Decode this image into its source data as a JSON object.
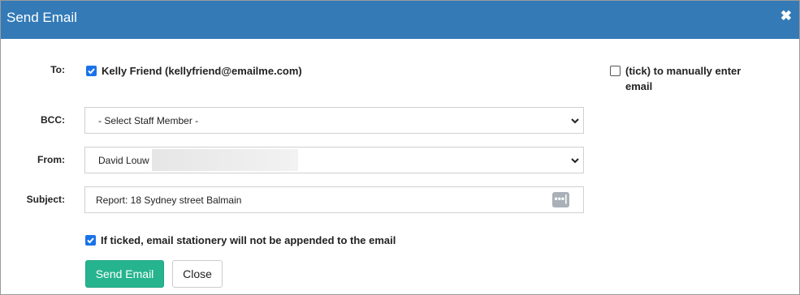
{
  "dialog": {
    "title": "Send Email",
    "close_icon": "close-icon"
  },
  "to": {
    "label": "To:",
    "recipient": "Kelly Friend (kellyfriend@emailme.com)",
    "recipient_checked": true,
    "manual_line1": "(tick) to manually enter",
    "manual_line2": "email",
    "manual_checked": false
  },
  "bcc": {
    "label": "BCC:",
    "selected": "- Select Staff Member -"
  },
  "from": {
    "label": "From:",
    "selected": "David Louw"
  },
  "subject": {
    "label": "Subject:",
    "value": "Report: 18 Sydney street Balmain",
    "dots": "•••|"
  },
  "stationery": {
    "text": "If ticked, email stationery will not be appended to the email",
    "checked": true
  },
  "buttons": {
    "send": "Send Email",
    "close": "Close"
  },
  "colors": {
    "header": "#337ab7",
    "primary": "#26b48f",
    "checkbox": "#1a73e8"
  }
}
